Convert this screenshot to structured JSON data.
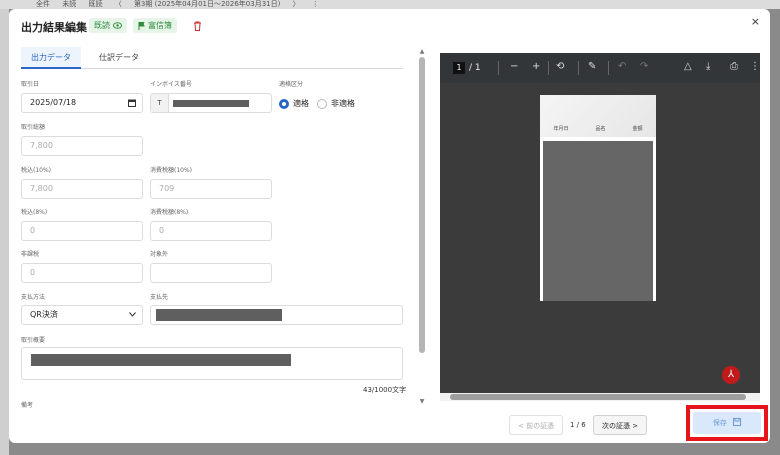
{
  "background": {
    "top_items": [
      "全件",
      "未読",
      "既読",
      "〈",
      "第3期 (2025年04月01日〜2026年03月31日)",
      "〉",
      "⋮"
    ]
  },
  "modal": {
    "title": "出力結果編集",
    "badge_view": "既読",
    "badge_mark": "富信簿",
    "close_glyph": "×",
    "tabs": [
      {
        "label": "出力データ",
        "active": true
      },
      {
        "label": "仕訳データ",
        "active": false
      }
    ],
    "form": {
      "date_label": "取引日",
      "date_value": "2025/07/18",
      "invoice_label": "インボイス番号",
      "invoice_prefix": "T",
      "qualified_label": "適格区分",
      "qualified_option": "適格",
      "unqualified_option": "非適格",
      "total_label": "取引総額",
      "total_value": "7,800",
      "tax10_label": "税込(10%)",
      "tax10_value": "7,800",
      "ctax10_label": "消費税額(10%)",
      "ctax10_value": "709",
      "tax8_label": "税込(8%)",
      "tax8_value": "0",
      "ctax8_label": "消費税額(8%)",
      "ctax8_value": "0",
      "notax_label": "非課税",
      "notax_value": "0",
      "exempt_label": "対象外",
      "exempt_value": "",
      "payment_label": "支払方法",
      "payment_value": "QR決済",
      "payee_label": "支払先",
      "summary_label": "取引概要",
      "summary_counter": "43/1000文字",
      "remarks_label": "備考"
    },
    "pdf": {
      "page_current": "1",
      "page_total": "/ 1",
      "col1": "年月日",
      "col2": "品名",
      "col3": "金額"
    },
    "footer": {
      "prev_label": "< 前の証憑",
      "page_info": "1 / 6",
      "next_label": "次の証憑 >",
      "save_label": "保存"
    },
    "colors": {
      "accent": "#2a66c4",
      "highlight": "#e8141b",
      "badge_bg": "#e6f5e8"
    }
  }
}
